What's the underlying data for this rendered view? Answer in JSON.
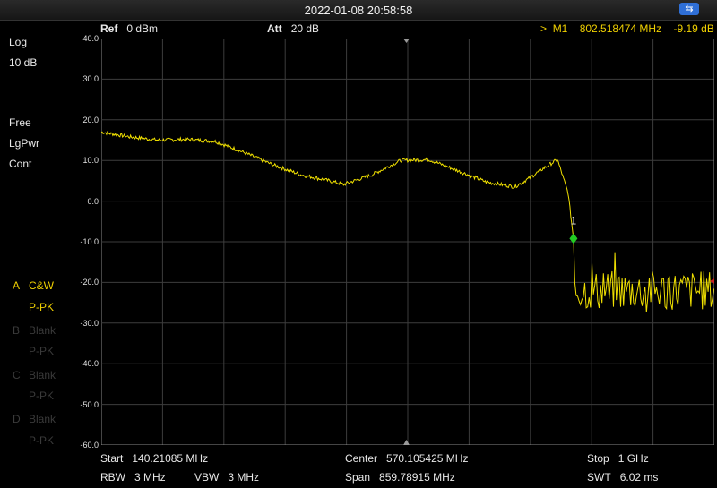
{
  "status": {
    "datetime": "2022-01-08 20:58:58",
    "usb_icon": "usb-icon"
  },
  "header": {
    "ref_label": "Ref",
    "ref_value": "0 dBm",
    "att_label": "Att",
    "att_value": "20 dB",
    "marker_prefix": ">",
    "marker_name": "M1",
    "marker_freq": "802.518474 MHz",
    "marker_amp": "-9.19 dB"
  },
  "left_panel": {
    "scale_type": "Log",
    "scale_div": "10 dB",
    "trigger": "Free",
    "avg_type": "LgPwr",
    "sweep": "Cont"
  },
  "traces": [
    {
      "id": "A",
      "mode": "C&W",
      "detector": "P-PK",
      "active": true
    },
    {
      "id": "B",
      "mode": "Blank",
      "detector": "P-PK",
      "active": false
    },
    {
      "id": "C",
      "mode": "Blank",
      "detector": "P-PK",
      "active": false
    },
    {
      "id": "D",
      "mode": "Blank",
      "detector": "P-PK",
      "active": false
    }
  ],
  "bottom": {
    "start_label": "Start",
    "start_value": "140.21085 MHz",
    "center_label": "Center",
    "center_value": "570.105425 MHz",
    "stop_label": "Stop",
    "stop_value": "1 GHz",
    "rbw_label": "RBW",
    "rbw_value": "3 MHz",
    "vbw_label": "VBW",
    "vbw_value": "3 MHz",
    "span_label": "Span",
    "span_value": "859.78915 MHz",
    "swt_label": "SWT",
    "swt_value": "6.02 ms"
  },
  "colors": {
    "trace": "#f0e000",
    "marker": "#22cc22",
    "grid": "#3d3d3d",
    "frame": "#8a8a8a"
  },
  "chart_data": {
    "type": "line",
    "x_unit": "MHz",
    "xlim": [
      140.21085,
      1000
    ],
    "ylim": [
      -60,
      40
    ],
    "y_ticks": [
      "40.0",
      "30.0",
      "20.0",
      "10.0",
      "0.0",
      "-10.0",
      "-20.0",
      "-30.0",
      "-40.0",
      "-50.0",
      "-60.0"
    ],
    "grid": true,
    "series": [
      {
        "x": [
          140.2,
          180,
          220,
          260,
          300,
          340,
          380,
          420,
          460,
          480,
          520,
          560,
          600,
          640,
          680,
          720,
          740,
          760,
          780,
          795,
          802.5
        ],
        "y": [
          17,
          15.8,
          15,
          15.2,
          14.7,
          12,
          9,
          6.5,
          5,
          4.1,
          6.5,
          10,
          10.2,
          7.5,
          4.7,
          3.5,
          5.6,
          8,
          10.2,
          2,
          -9.19
        ]
      }
    ],
    "noise_floor": {
      "x_start": 802.5,
      "x_end": 1000,
      "y_min": -31,
      "y_max": -13
    },
    "marker": {
      "label": "1",
      "x": 802.518474,
      "y": -9.19
    }
  }
}
